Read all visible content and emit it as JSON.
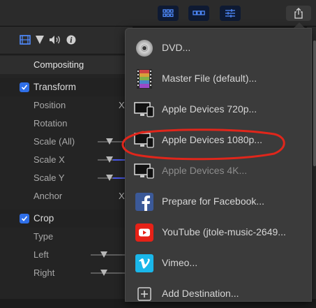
{
  "toolbar": {
    "buttons": [
      {
        "name": "browser-grid-icon",
        "state": "active"
      },
      {
        "name": "timeline-icon",
        "state": "active"
      },
      {
        "name": "inspector-sliders-icon",
        "state": "active"
      },
      {
        "name": "share-icon",
        "state": "plain"
      }
    ]
  },
  "inspector": {
    "tabs": [
      "film-icon",
      "filter-icon",
      "audio-icon",
      "info-icon"
    ],
    "compositing_label": "Compositing",
    "transform": {
      "label": "Transform",
      "params": {
        "position": "Position",
        "rotation": "Rotation",
        "scale_all": "Scale (All)",
        "scale_x": "Scale X",
        "scale_y": "Scale Y",
        "anchor": "Anchor"
      },
      "x_label": "X"
    },
    "crop": {
      "label": "Crop",
      "params": {
        "type": "Type",
        "left": "Left",
        "right": "Right"
      }
    }
  },
  "share_menu": {
    "items": [
      {
        "label": "DVD...",
        "icon": "dvd-icon"
      },
      {
        "label": "Master File (default)...",
        "icon": "film-strip-icon"
      },
      {
        "label": "Apple Devices 720p...",
        "icon": "apple-devices-icon"
      },
      {
        "label": "Apple Devices 1080p...",
        "icon": "apple-devices-icon"
      },
      {
        "label": "Apple Devices 4K...",
        "icon": "apple-devices-icon"
      },
      {
        "label": "Prepare for Facebook...",
        "icon": "facebook-icon"
      },
      {
        "label": "YouTube (jtole-music-2649...",
        "icon": "youtube-icon"
      },
      {
        "label": "Vimeo...",
        "icon": "vimeo-icon"
      },
      {
        "label": "Add Destination...",
        "icon": "add-icon"
      }
    ]
  },
  "colors": {
    "accent": "#2f6fe8",
    "annotation": "#e0261b",
    "facebook": "#3b5998",
    "youtube": "#e62117",
    "vimeo": "#1ab7ea"
  }
}
